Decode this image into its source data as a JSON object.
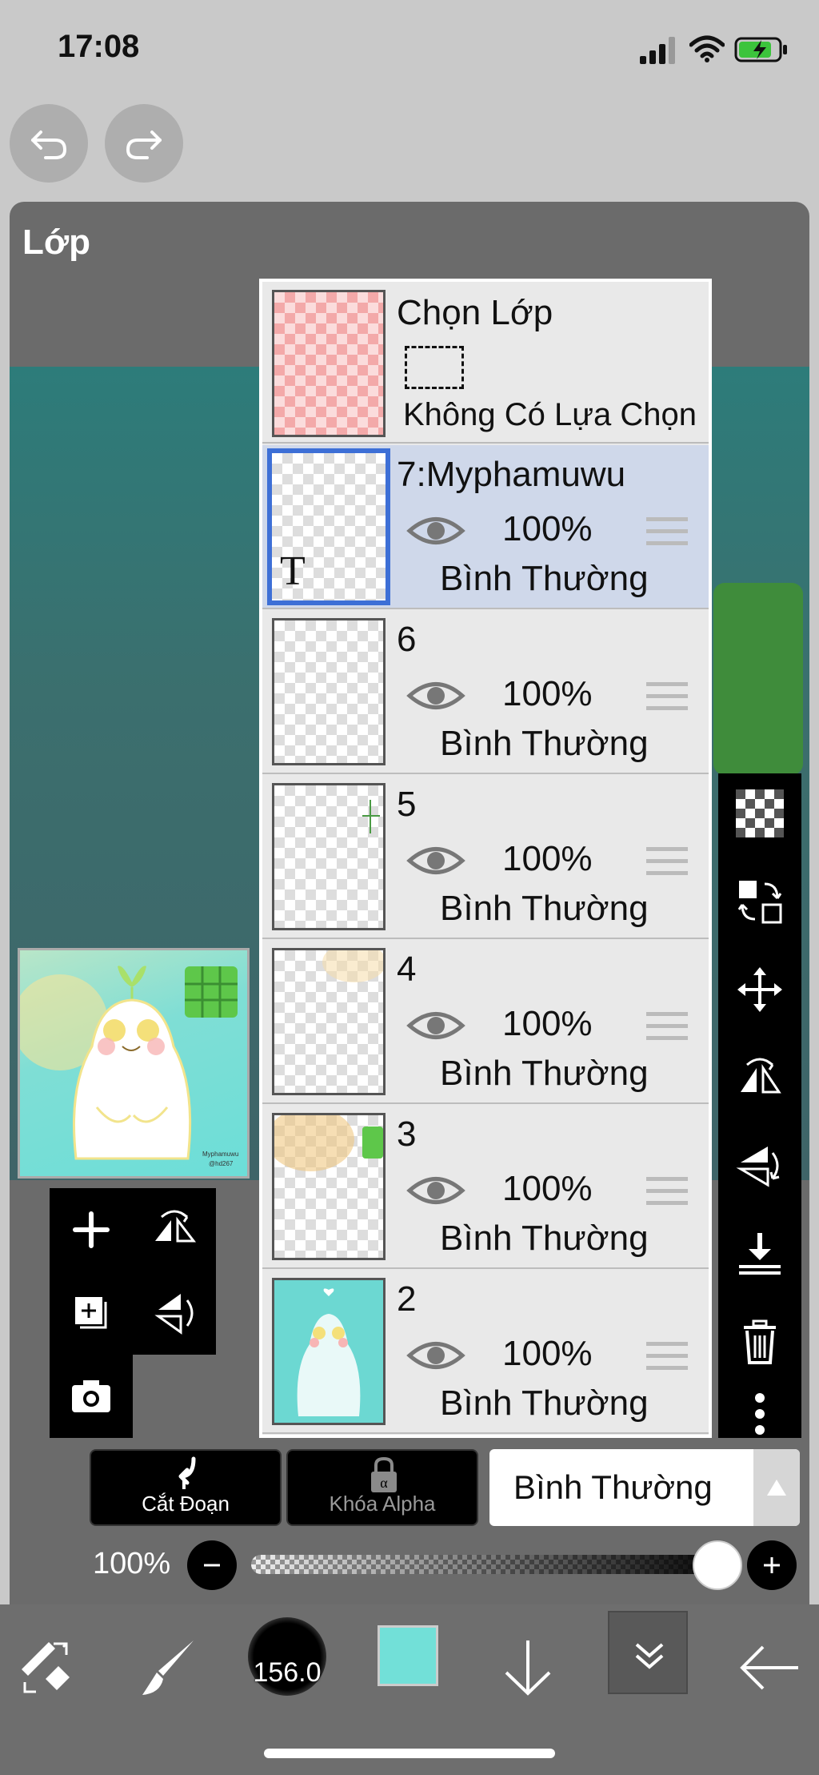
{
  "status_bar": {
    "time": "17:08"
  },
  "panel": {
    "title": "Lớp"
  },
  "selection_layer": {
    "title": "Chọn Lớp",
    "subtitle": "Không Có Lựa Chọn"
  },
  "layers": [
    {
      "name": "7:Myphamuwu",
      "opacity": "100%",
      "blend": "Bình Thường",
      "active": true
    },
    {
      "name": "6",
      "opacity": "100%",
      "blend": "Bình Thường",
      "active": false
    },
    {
      "name": "5",
      "opacity": "100%",
      "blend": "Bình Thường",
      "active": false
    },
    {
      "name": "4",
      "opacity": "100%",
      "blend": "Bình Thường",
      "active": false
    },
    {
      "name": "3",
      "opacity": "100%",
      "blend": "Bình Thường",
      "active": false
    },
    {
      "name": "2",
      "opacity": "100%",
      "blend": "Bình Thường",
      "active": false
    }
  ],
  "controls": {
    "clipping_label": "Cắt Đoạn",
    "alpha_lock_label": "Khóa Alpha",
    "blend_mode": "Bình Thường",
    "opacity_label": "100%",
    "opacity_value": 1.0
  },
  "bottom_bar": {
    "brush_size": "156.0",
    "color": "#72e0d8"
  },
  "thumbnail": {
    "signature_line1": "Myphamuwu",
    "signature_line2": "@hd267"
  },
  "colors": {
    "accent": "#3d6fd6",
    "panel": "#6b6b6b",
    "active_row": "#cfd8ea"
  }
}
